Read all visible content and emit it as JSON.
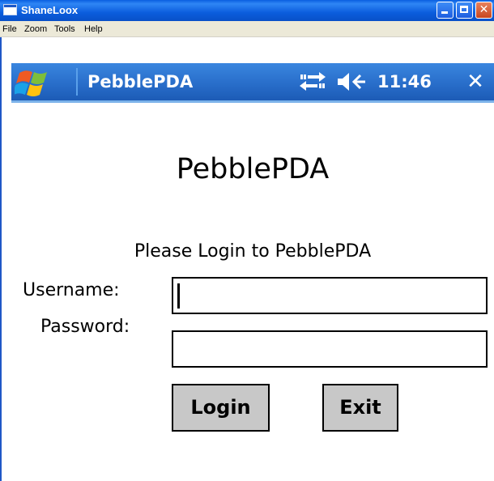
{
  "window": {
    "title": "ShaneLoox",
    "buttons": {
      "minimize": "",
      "maximize": "",
      "close": "✕"
    }
  },
  "menubar": {
    "items": [
      "File",
      "Zoom",
      "Tools",
      "Help"
    ]
  },
  "taskbar": {
    "app_title": "PebblePDA",
    "time": "11:46",
    "close_glyph": "✕",
    "icons": [
      "windows-flag-icon",
      "connectivity-icon",
      "volume-icon",
      "close-icon"
    ]
  },
  "app": {
    "heading": "PebblePDA",
    "prompt": "Please Login to PebblePDA",
    "username_label": "Username:",
    "username_value": "",
    "password_label": "Password:",
    "password_value": "",
    "login_button": "Login",
    "exit_button": "Exit"
  },
  "colors": {
    "xp_titlebar": "#0a5fe0",
    "wm_taskbar": "#2a70cc",
    "button_face": "#c8c8c8",
    "background": "#ffffff"
  }
}
